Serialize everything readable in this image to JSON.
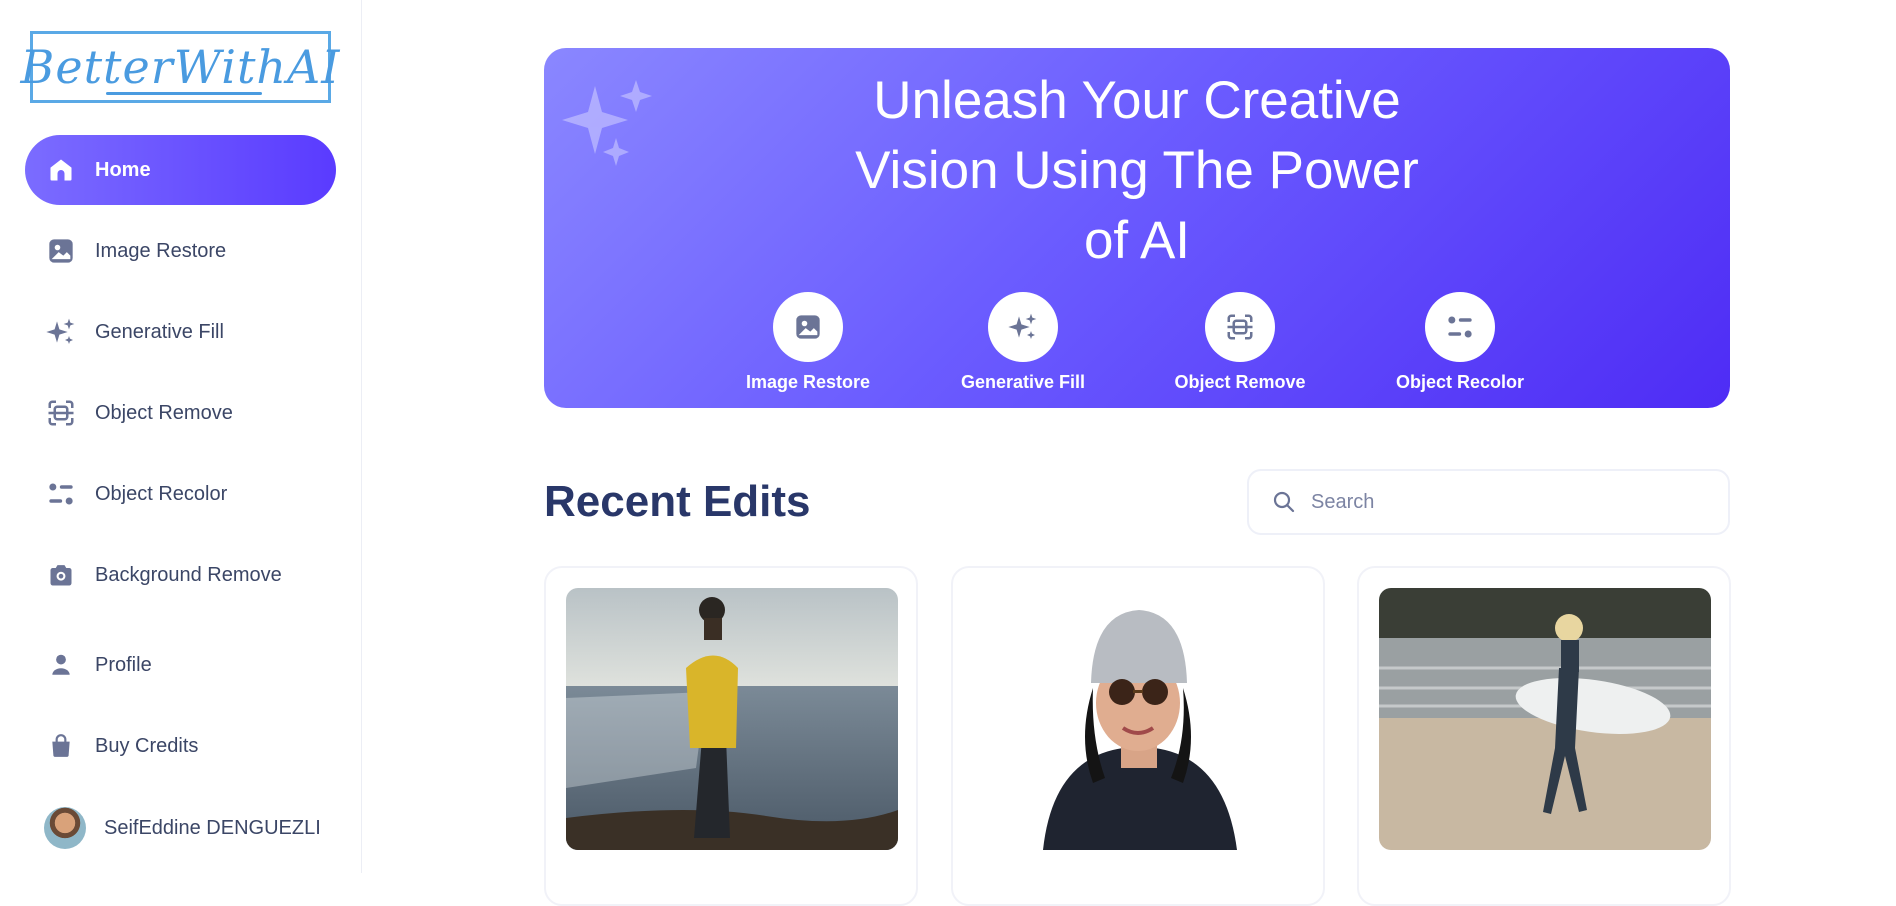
{
  "brand": {
    "logo_text": "BetterWithAI"
  },
  "sidebar": {
    "items": [
      {
        "label": "Home",
        "icon": "home-icon",
        "active": true
      },
      {
        "label": "Image Restore",
        "icon": "image-icon"
      },
      {
        "label": "Generative Fill",
        "icon": "sparkles-icon"
      },
      {
        "label": "Object Remove",
        "icon": "scan-icon"
      },
      {
        "label": "Object Recolor",
        "icon": "filter-icon"
      },
      {
        "label": "Background Remove",
        "icon": "camera-icon"
      },
      {
        "label": "Profile",
        "icon": "user-icon"
      },
      {
        "label": "Buy Credits",
        "icon": "bag-icon"
      }
    ],
    "user": {
      "name": "SeifEddine DENGUEZLI"
    }
  },
  "hero": {
    "title_lines": [
      "Unleash Your Creative",
      "Vision Using The Power",
      "of AI"
    ],
    "tools": [
      {
        "label": "Image Restore",
        "icon": "image-icon"
      },
      {
        "label": "Generative Fill",
        "icon": "sparkles-icon"
      },
      {
        "label": "Object Remove",
        "icon": "scan-icon"
      },
      {
        "label": "Object Recolor",
        "icon": "filter-icon"
      }
    ]
  },
  "recent": {
    "title": "Recent Edits",
    "search_placeholder": "Search",
    "cards": [
      {
        "image": "man-yellow-jacket-by-sea"
      },
      {
        "image": "woman-beanie-sunglasses"
      },
      {
        "image": "surfer-on-beach"
      }
    ]
  },
  "colors": {
    "accent_start": "#7b6cff",
    "accent_end": "#4e2cf5",
    "heading": "#293769",
    "icon_muted": "#6b7496"
  }
}
